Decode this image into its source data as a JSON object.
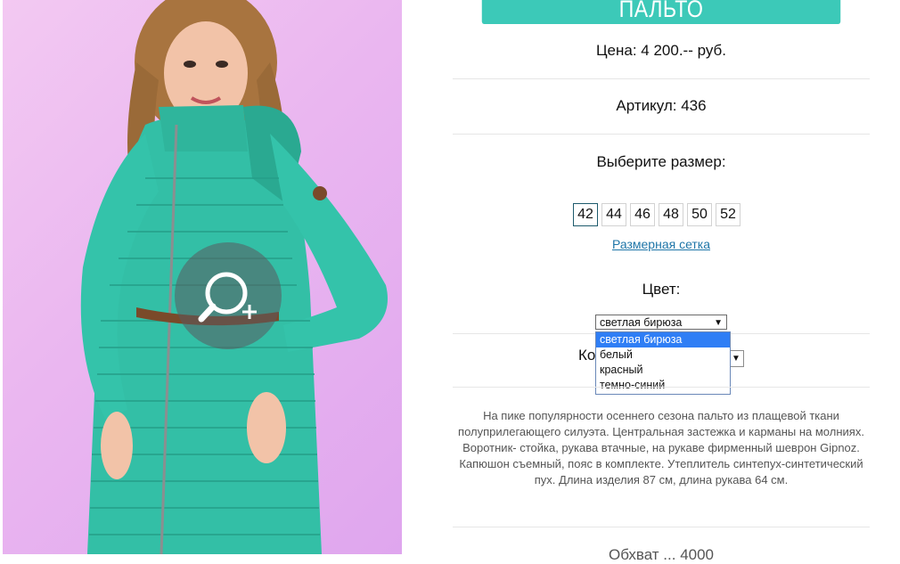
{
  "product": {
    "title": "ПАЛЬТО",
    "price": "Цена: 4 200.-- руб.",
    "article": "Артикул: 436",
    "size_prompt": "Выберите размер:",
    "sizes": [
      "42",
      "44",
      "46",
      "48",
      "50",
      "52"
    ],
    "selected_size": "42",
    "size_chart_link": "Размерная сетка",
    "color_label": "Цвет:",
    "color_selected": "светлая бирюза",
    "color_options": [
      "светлая бирюза",
      "белый",
      "красный",
      "темно-синий"
    ],
    "qty_label_partial": "Ко",
    "description": "На пике популярности осеннего сезона пальто из плащевой ткани полуприлегающего силуэта. Центральная застежка и карманы на молниях. Воротник- стойка, рукава втачные, на рукаве фирменный шеврон Gipnoz. Капюшон съемный, пояс в комплекте. Утеплитель синтепух-синтетический пух. Длина изделия 87 см, длина рукава 64 см.",
    "footer_partial": "Обхват ... 4000"
  },
  "colors": {
    "accent": "#3cc9b8",
    "link": "#1f76a8",
    "dropdown_highlight": "#2f7ef5"
  },
  "icons": {
    "zoom": "magnifier-plus-icon",
    "dropdown": "triangle-down-icon"
  }
}
